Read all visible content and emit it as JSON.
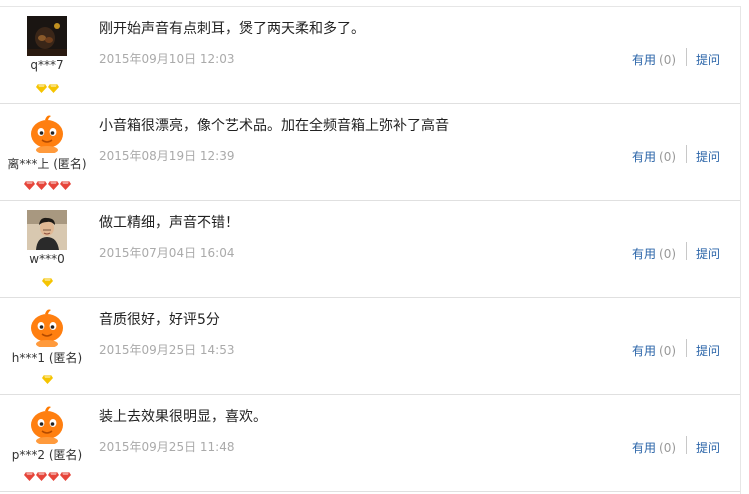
{
  "reviews": [
    {
      "avatar": "dark-photo",
      "user": "q***7",
      "level": {
        "gems": 2,
        "color": "#f5c400"
      },
      "content": "刚开始声音有点刺耳，煲了两天柔和多了。",
      "date": "2015年09月10日 12:03",
      "useful_label": "有用",
      "useful_count": "(0)",
      "ask_label": "提问"
    },
    {
      "avatar": "orange-mascot",
      "user": "离***上 (匿名)",
      "level": {
        "gems": 4,
        "color": "#e6453a"
      },
      "content": "小音箱很漂亮，像个艺术品。加在全频音箱上弥补了高音",
      "date": "2015年08月19日 12:39",
      "useful_label": "有用",
      "useful_count": "(0)",
      "ask_label": "提问"
    },
    {
      "avatar": "person-photo",
      "user": "w***0",
      "level": {
        "gems": 1,
        "color": "#f5c400"
      },
      "content": "做工精细，声音不错！",
      "date": "2015年07月04日 16:04",
      "useful_label": "有用",
      "useful_count": "(0)",
      "ask_label": "提问"
    },
    {
      "avatar": "orange-mascot",
      "user": "h***1 (匿名)",
      "level": {
        "gems": 1,
        "color": "#f5c400"
      },
      "content": "音质很好，好评5分",
      "date": "2015年09月25日 14:53",
      "useful_label": "有用",
      "useful_count": "(0)",
      "ask_label": "提问"
    },
    {
      "avatar": "orange-mascot",
      "user": "p***2 (匿名)",
      "level": {
        "gems": 4,
        "color": "#e6453a"
      },
      "content": "装上去效果很明显，喜欢。",
      "date": "2015年09月25日 11:48",
      "useful_label": "有用",
      "useful_count": "(0)",
      "ask_label": "提问"
    }
  ]
}
